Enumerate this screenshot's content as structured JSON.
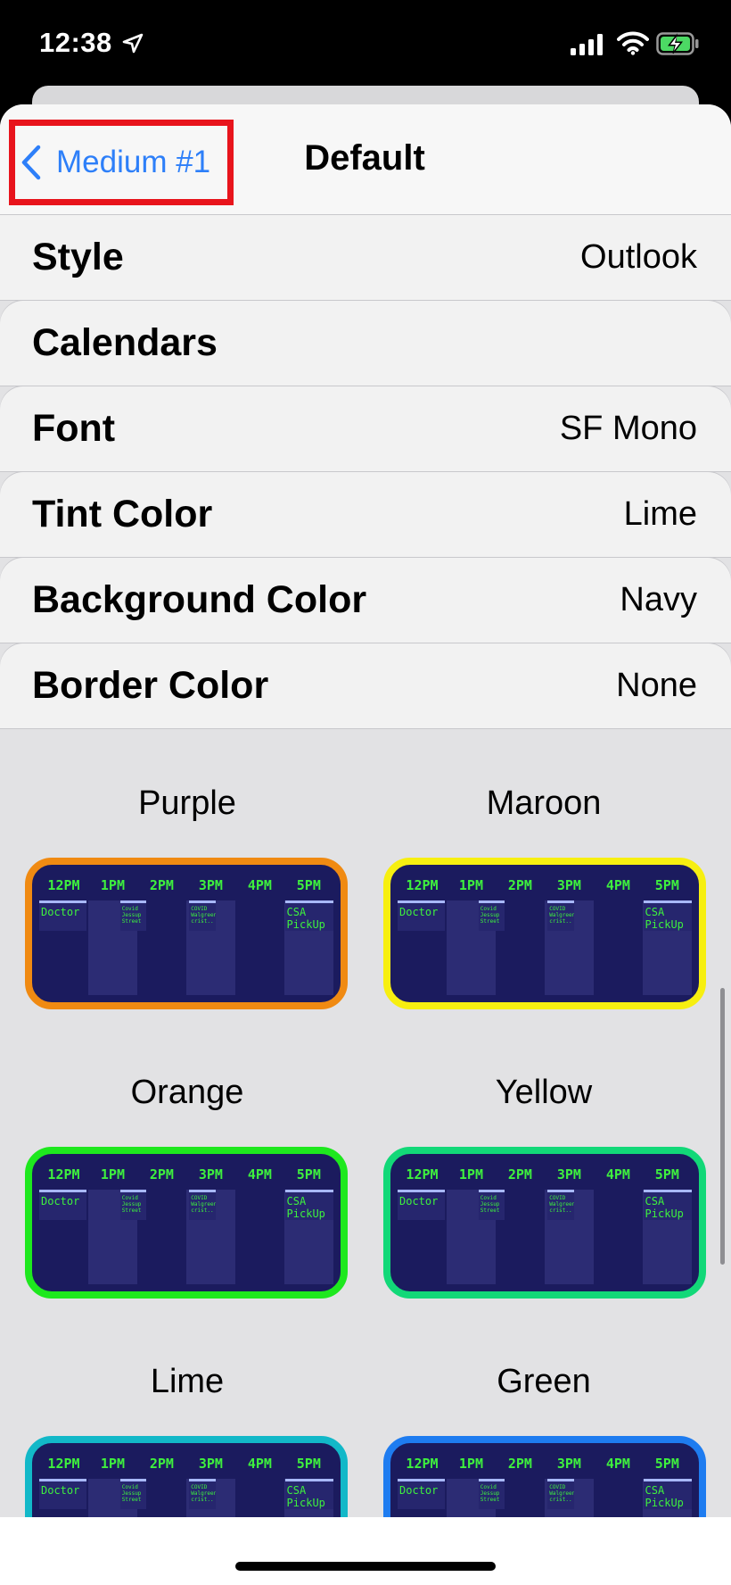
{
  "status_bar": {
    "time": "12:38"
  },
  "nav": {
    "back_label": "Medium #1",
    "title": "Default"
  },
  "settings": [
    {
      "label": "Style",
      "value": "Outlook"
    },
    {
      "label": "Calendars",
      "value": ""
    },
    {
      "label": "Font",
      "value": "SF Mono"
    },
    {
      "label": "Tint Color",
      "value": "Lime"
    },
    {
      "label": "Background Color",
      "value": "Navy"
    },
    {
      "label": "Border Color",
      "value": "None"
    }
  ],
  "widget_preview": {
    "hours": [
      "12PM",
      "1PM",
      "2PM",
      "3PM",
      "4PM",
      "5PM"
    ],
    "events": {
      "doctor": "Doctor",
      "covid": "Covid Jessup Street",
      "covid19": "COVID Walgreen crist..",
      "csa": "CSA PickUp"
    }
  },
  "options": [
    {
      "label": "Purple",
      "border_color": "#f08a12"
    },
    {
      "label": "Maroon",
      "border_color": "#f7ef10"
    },
    {
      "label": "Orange",
      "border_color": "#1ee81e"
    },
    {
      "label": "Yellow",
      "border_color": "#12d878"
    },
    {
      "label": "Lime",
      "border_color": "#12b8c8"
    },
    {
      "label": "Green",
      "border_color": "#1e7cf0"
    }
  ],
  "colors": {
    "accent": "#2d7ff9",
    "highlight_box": "#e8141c",
    "widget_background": "#1b1b5e",
    "tint": "#3ef03e"
  }
}
